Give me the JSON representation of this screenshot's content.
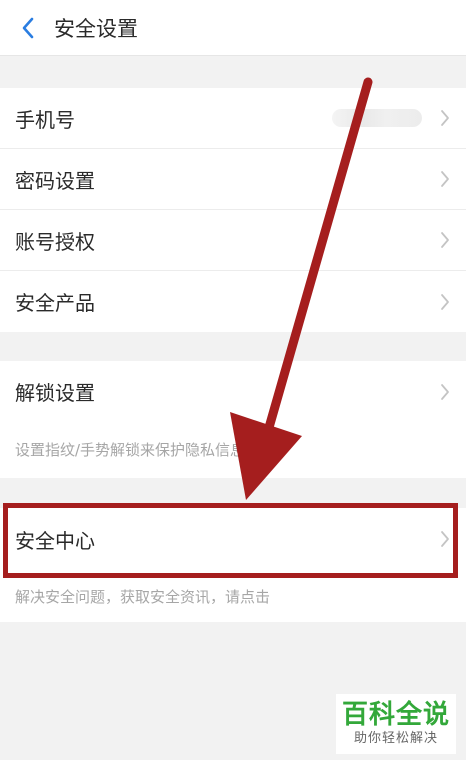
{
  "header": {
    "title": "安全设置",
    "back_icon": "chevron-left-icon",
    "accent": "#2a7de1"
  },
  "group1": {
    "items": [
      {
        "label": "手机号",
        "value_state": "blurred"
      },
      {
        "label": "密码设置"
      },
      {
        "label": "账号授权"
      },
      {
        "label": "安全产品"
      }
    ]
  },
  "group2": {
    "item": {
      "label": "解锁设置"
    },
    "caption": "设置指纹/手势解锁来保护隐私信息"
  },
  "group3": {
    "item": {
      "label": "安全中心"
    },
    "caption": "解决安全问题，获取安全资讯，请点击"
  },
  "annotation": {
    "color": "#a51e1e",
    "arrow_icon": "red-arrow-annotation",
    "highlight": "安全中心"
  },
  "watermark": {
    "main": "百科全说",
    "sub": "助你轻松解决",
    "color": "#33a83a"
  }
}
